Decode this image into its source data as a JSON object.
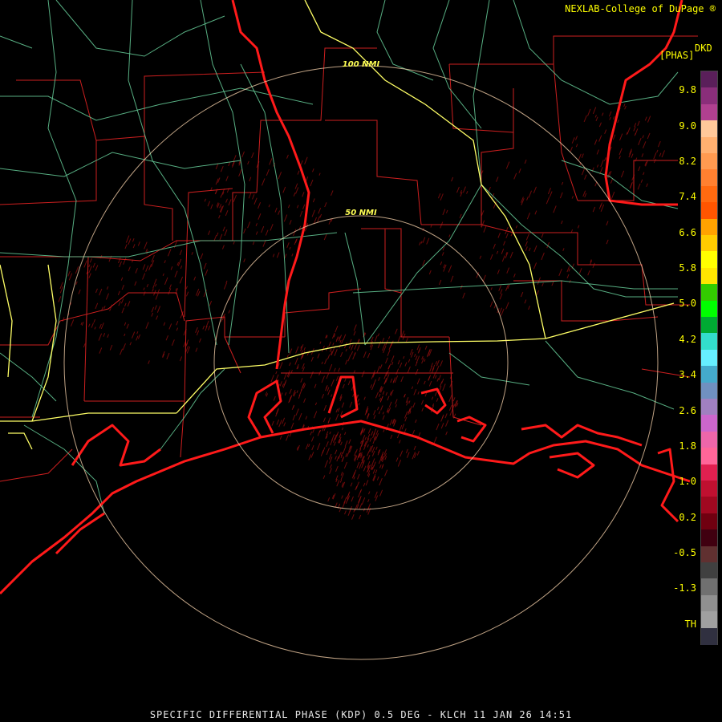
{
  "credit": "NEXLAB-College of DuPage",
  "credit_mark": "®",
  "units": {
    "top": "DKD",
    "sub": "[PHAS]"
  },
  "footer": "SPECIFIC DIFFERENTIAL PHASE (KDP) 0.5 DEG - KLCH 11 JAN 26 14:51",
  "range_rings": [
    {
      "label": "50 NMI"
    },
    {
      "label": "100 NMI"
    }
  ],
  "legend": {
    "labels": [
      "9.8",
      "9.0",
      "8.2",
      "7.4",
      "6.6",
      "5.8",
      "5.0",
      "4.2",
      "3.4",
      "2.6",
      "1.8",
      "1.0",
      "0.2",
      "-0.5",
      "-1.3",
      "TH"
    ],
    "colors": [
      "#5a1f5a",
      "#8a2e7a",
      "#b04090",
      "#ffc89a",
      "#ffb070",
      "#ff9a50",
      "#ff8030",
      "#ff6a10",
      "#ff5500",
      "#ffa200",
      "#ffcc00",
      "#ffff00",
      "#ffe600",
      "#33cc00",
      "#00ff00",
      "#00aa33",
      "#33ddcc",
      "#66eeff",
      "#44aacc",
      "#7090c0",
      "#a080c0",
      "#cc66cc",
      "#ee66aa",
      "#ff6699",
      "#e02050",
      "#c01030",
      "#a00820",
      "#700010",
      "#400010",
      "#603030",
      "#404040",
      "#707070",
      "#909090",
      "#a0a0a0",
      "#303040"
    ]
  },
  "colors": {
    "coast": "#ff1a1a",
    "county": "#cc1f1f",
    "highway_minor": "#66cc99",
    "highway_major": "#ffff66",
    "ring": "#ffd8b0",
    "echo": "#9a1010"
  }
}
